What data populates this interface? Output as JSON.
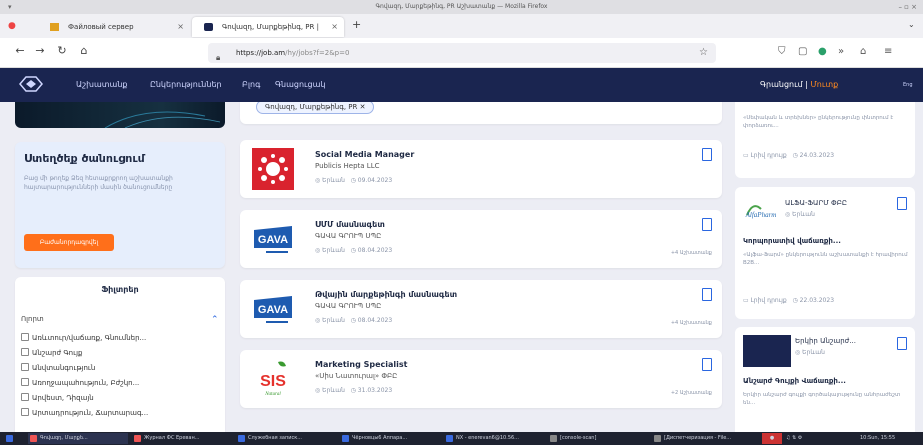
{
  "window": {
    "title": "Գովազդ, Մարքեթինգ, PR Աշխատանք — Mozilla Firefox"
  },
  "tabs": [
    {
      "label": "Файловый сервер",
      "active": false
    },
    {
      "label": "Գովազդ, Մարքեթինգ, PR |",
      "active": true
    }
  ],
  "nav": {
    "url_host": "https://job.am",
    "url_path": "/hy/jobs?f=2&p=0"
  },
  "site": {
    "menu": [
      "Աշխատանք",
      "Ընկերություններ",
      "Բլոգ",
      "Գնացուցակ"
    ],
    "login": "Գրանցում",
    "login_sep": " | ",
    "login2": "Մուտք",
    "lang": "Eng"
  },
  "subscribe": {
    "title": "Ստեղծեք ծանուցում",
    "text": "Բաց մի թողեք Ձեզ հետաքրքրող աշխատանքի հայտարարությունների մասին ծանուցումները",
    "button": "Բաժանորդագրվել"
  },
  "filters": {
    "title": "Ֆիլտրեր",
    "section": "Ոլորտ",
    "items": [
      "Առևտուր/վաճառք, Գնումներ...",
      "Անշարժ Գույք",
      "Անվտանգություն",
      "Առողջապահություն, Բժշկո...",
      "Արվեստ, Դիզայն",
      "Արտադրություն, Ճարտարագ..."
    ]
  },
  "chip": "Գովազդ, Մարքեթինգ, PR",
  "jobs": [
    {
      "title": "Social Media Manager",
      "company": "Publicis Hepta LLC",
      "city": "Երևան",
      "date": "09.04.2023",
      "more": ""
    },
    {
      "title": "ՍՄՄ մասնագետ",
      "company": "ԳԱՎԱ ԳՐՈՒՊ ՍՊԸ",
      "city": "Երևան",
      "date": "08.04.2023",
      "more": "+4 Աշխատանք"
    },
    {
      "title": "Թվային մարքեթինգի մասնագետ",
      "company": "ԳԱՎԱ ԳՐՈՒՊ ՍՊԸ",
      "city": "Երևան",
      "date": "08.04.2023",
      "more": "+4 Աշխատանք"
    },
    {
      "title": "Marketing Specialist",
      "company": "«Սիս Նատուրալ» ՓԲԸ",
      "city": "Երևան",
      "date": "31.03.2023",
      "more": "+2 Աշխատանք"
    }
  ],
  "side": [
    {
      "desc": "«Սեփական և տրեխներ» ընկերությունը փնտրում է փորձառու...",
      "type": "Լրիվ դրույք",
      "date": "24.03.2023"
    },
    {
      "company": "ԱԼՖԱ-ՖԱՐՄ ՓԲԸ",
      "city": "Երևան",
      "title": "Կորպորատիվ վաճառքի...",
      "desc": "«Ալֆա-Ֆարմ» ընկերությունն աշխատանքի է հրավիրում B2B...",
      "type": "Լրիվ դրույք",
      "date": "22.03.2023"
    },
    {
      "company": "Երկիր Անշարժ...",
      "city": "Երևան",
      "title": "Անշարժ Գույքի Վաճառքի...",
      "desc": "Երկիր անշարժ գույքի գործակալությունը անհրաժեշտ են..."
    }
  ],
  "taskbar": [
    "Գովազդ, Մարքե...",
    "Журнал ФС Ереван...",
    "Служебная записк...",
    "Чёрновцы6 Аппара...",
    "NX - enerevan6@10.56...",
    "[console-scan]",
    "[Диспетчеризация - File...",
    "10:Sun, 15:55"
  ],
  "colors": {
    "brand": "#1a2550",
    "accent": "#ff6f1a",
    "link": "#2a66e0"
  }
}
